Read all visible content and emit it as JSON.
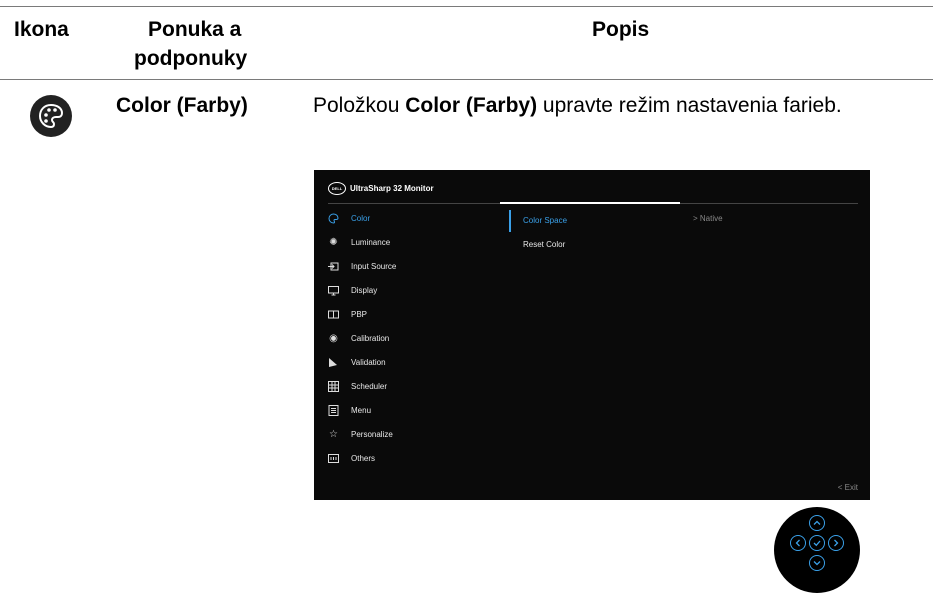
{
  "table": {
    "headers": {
      "icon": "Ikona",
      "menu_line1": "Ponuka a",
      "menu_line2": "podponuky",
      "description": "Popis"
    },
    "row": {
      "menu_name": "Color (Farby)",
      "desc_prefix": "Položkou ",
      "desc_bold": "Color (Farby)",
      "desc_suffix": " upravte režim nastavenia farieb."
    }
  },
  "osd": {
    "logo": "DELL",
    "title": "UltraSharp 32 Monitor",
    "menu": [
      {
        "label": "Color",
        "icon": "palette-icon",
        "active": true
      },
      {
        "label": "Luminance",
        "icon": "brightness-icon"
      },
      {
        "label": "Input Source",
        "icon": "input-source-icon"
      },
      {
        "label": "Display",
        "icon": "display-icon"
      },
      {
        "label": "PBP",
        "icon": "pbp-icon"
      },
      {
        "label": "Calibration",
        "icon": "calibration-icon"
      },
      {
        "label": "Validation",
        "icon": "validation-icon"
      },
      {
        "label": "Scheduler",
        "icon": "scheduler-icon"
      },
      {
        "label": "Menu",
        "icon": "menu-icon"
      },
      {
        "label": "Personalize",
        "icon": "star-icon"
      },
      {
        "label": "Others",
        "icon": "others-icon"
      }
    ],
    "submenu": [
      {
        "label": "Color Space",
        "active": true
      },
      {
        "label": "Reset Color"
      }
    ],
    "value": "> Native",
    "exit": "< Exit",
    "accent_color": "#3aa0e8"
  }
}
